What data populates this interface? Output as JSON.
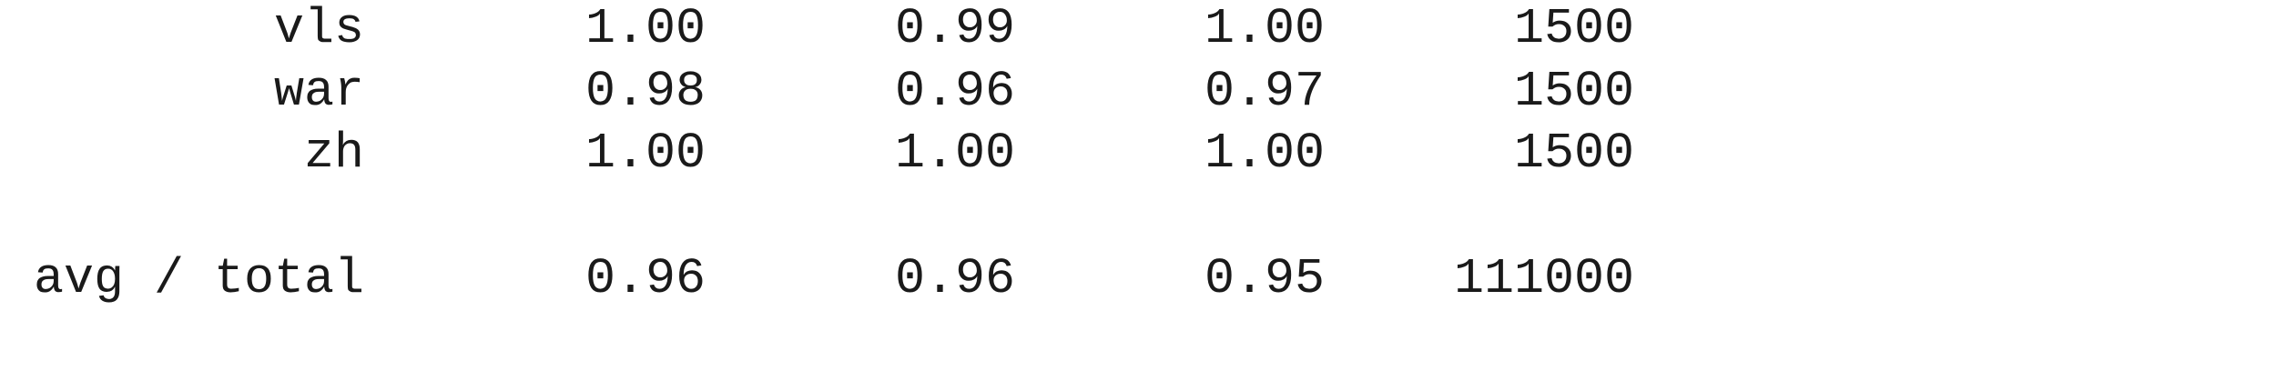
{
  "rows": [
    {
      "label": "vls",
      "precision": "1.00",
      "recall": "0.99",
      "f1": "1.00",
      "support": "1500"
    },
    {
      "label": "war",
      "precision": "0.98",
      "recall": "0.96",
      "f1": "0.97",
      "support": "1500"
    },
    {
      "label": "zh",
      "precision": "1.00",
      "recall": "1.00",
      "f1": "1.00",
      "support": "1500"
    }
  ],
  "total": {
    "label": "avg / total",
    "precision": "0.96",
    "recall": "0.96",
    "f1": "0.95",
    "support": "111000"
  }
}
